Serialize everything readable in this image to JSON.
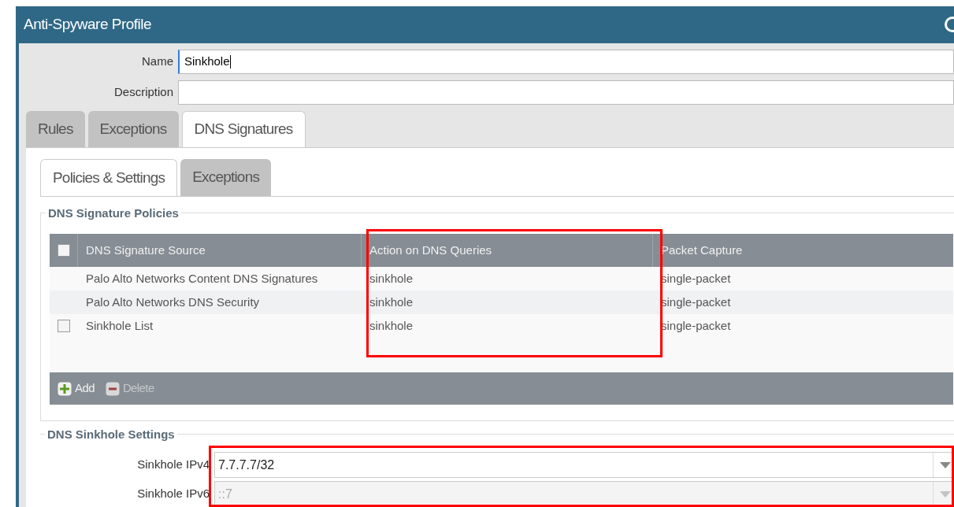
{
  "window": {
    "title": "Anti-Spyware Profile"
  },
  "fields": [
    {
      "label": "Name",
      "value": "Sinkhole",
      "focused": true
    },
    {
      "label": "Description",
      "focused": false
    }
  ],
  "tabs": [
    {
      "label": "Rules",
      "selected": false
    },
    {
      "label": "Exceptions",
      "selected": false
    },
    {
      "label": "DNS Signatures",
      "selected": true
    }
  ],
  "subtabs": [
    {
      "label": "Policies & Settings",
      "selected": true
    },
    {
      "label": "Exceptions",
      "selected": false
    }
  ],
  "policies": {
    "title": "DNS Signature Policies",
    "header_checked": false,
    "columns": [
      "DNS Signature Source",
      "Action on DNS Queries",
      "Packet Capture"
    ],
    "rows": [
      {
        "kind": "predefined",
        "cells": [
          "Palo Alto Networks Content DNS Signatures",
          "sinkhole",
          "single-packet"
        ]
      },
      {
        "kind": "predefined",
        "cells": [
          "Palo Alto Networks DNS Security",
          "sinkhole",
          "single-packet"
        ]
      },
      {
        "kind": "custom",
        "checked": false,
        "cells": [
          "Sinkhole List",
          "sinkhole",
          "single-packet"
        ]
      }
    ],
    "buttons": [
      {
        "kind": "add",
        "label": "Add",
        "disabled": false
      },
      {
        "kind": "delete",
        "label": "Delete",
        "disabled": true
      }
    ]
  },
  "sinkhole": {
    "title": "DNS Sinkhole Settings",
    "fields": [
      {
        "label": "Sinkhole IPv4",
        "value": "7.7.7.7/32",
        "disabled": false
      },
      {
        "label": "Sinkhole IPv6",
        "value": "::7",
        "disabled": true
      }
    ]
  }
}
